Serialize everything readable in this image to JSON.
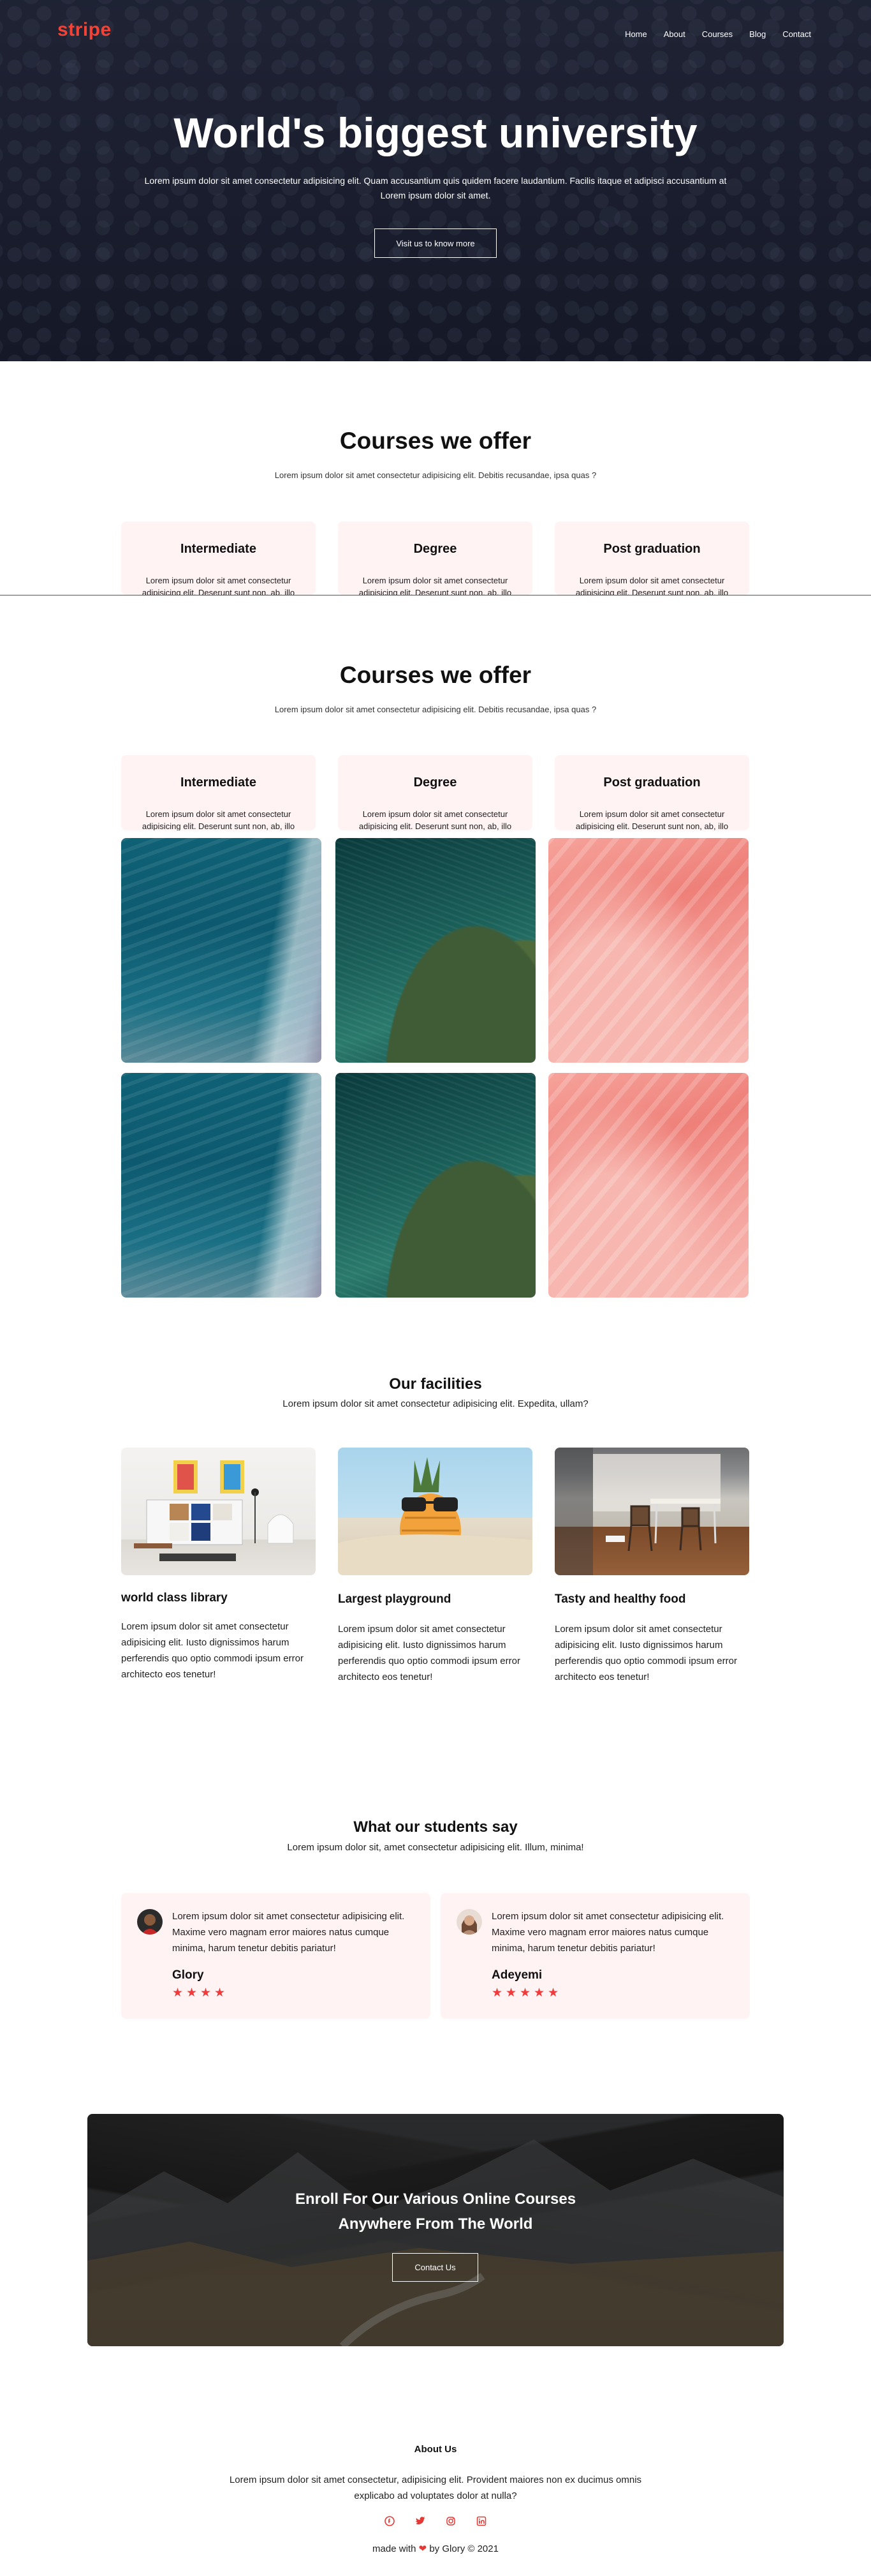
{
  "header": {
    "logo": "stripe",
    "nav": [
      "Home",
      "About",
      "Courses",
      "Blog",
      "Contact"
    ]
  },
  "hero": {
    "title": "World's biggest university",
    "text": "Lorem ipsum dolor sit amet consectetur adipisicing elit. Quam accusantium quis quidem facere laudantium. Facilis itaque et adipisci accusantium at Lorem ipsum dolor sit amet.",
    "button": "Visit us to know more"
  },
  "courses": {
    "title": "Courses we offer",
    "subtitle": "Lorem ipsum dolor sit amet consectetur adipisicing elit. Debitis recusandae, ipsa quas ?",
    "cards": [
      {
        "title": "Intermediate",
        "text": "Lorem ipsum dolor sit amet consectetur adipisicing elit. Deserunt sunt non, ab, illo"
      },
      {
        "title": "Degree",
        "text": "Lorem ipsum dolor sit amet consectetur adipisicing elit. Deserunt sunt non, ab, illo"
      },
      {
        "title": "Post graduation",
        "text": "Lorem ipsum dolor sit amet consectetur adipisicing elit. Deserunt sunt non, ab, illo"
      }
    ]
  },
  "facilities": {
    "title": "Our facilities",
    "subtitle": "Lorem ipsum dolor sit amet consectetur adipisicing elit. Expedita, ullam?",
    "items": [
      {
        "name": "world class library",
        "text": "Lorem ipsum dolor sit amet consectetur adipisicing elit. Iusto dignissimos harum perferendis quo optio commodi ipsum error architecto eos tenetur!"
      },
      {
        "name": "Largest playground",
        "text": "Lorem ipsum dolor sit amet consectetur adipisicing elit. Iusto dignissimos harum perferendis quo optio commodi ipsum error architecto eos tenetur!"
      },
      {
        "name": "Tasty and healthy food",
        "text": "Lorem ipsum dolor sit amet consectetur adipisicing elit. Iusto dignissimos harum perferendis quo optio commodi ipsum error architecto eos tenetur!"
      }
    ]
  },
  "testimonials": {
    "title": "What our students say",
    "subtitle": "Lorem ipsum dolor sit, amet consectetur adipisicing elit. Illum, minima!",
    "items": [
      {
        "text": "Lorem ipsum dolor sit amet consectetur adipisicing elit. Maxime vero magnam error maiores natus cumque minima, harum tenetur debitis pariatur!",
        "name": "Glory",
        "rating": 4
      },
      {
        "text": "Lorem ipsum dolor sit amet consectetur adipisicing elit. Maxime vero magnam error maiores natus cumque minima, harum tenetur debitis pariatur!",
        "name": "Adeyemi",
        "rating": 5
      }
    ]
  },
  "cta": {
    "line1": "Enroll For Our Various Online Courses",
    "line2": "Anywhere From The World",
    "button": "Contact Us"
  },
  "footer": {
    "title": "About Us",
    "text": "Lorem ipsum dolor sit amet consectetur, adipisicing elit. Provident maiores non ex ducimus omnis explicabo ad voluptates dolor at nulla?",
    "social_icons": [
      "facebook-icon",
      "twitter-icon",
      "instagram-icon",
      "linkedin-icon"
    ],
    "copyright_before": "made with",
    "copyright_after": "by Glory © 2021"
  },
  "colors": {
    "brand": "#f44336",
    "card_bg": "#fff3f3",
    "star": "#ef3b3b"
  }
}
